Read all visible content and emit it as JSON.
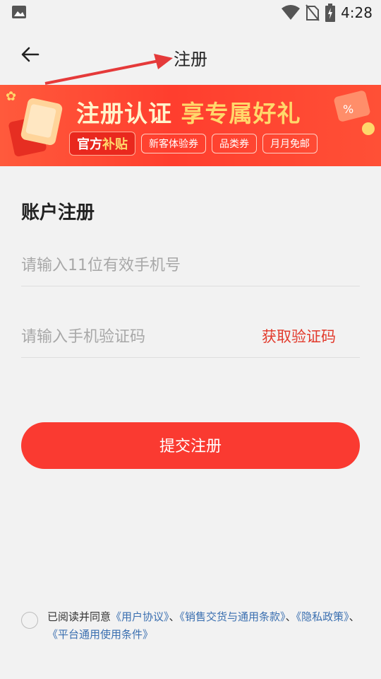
{
  "status_bar": {
    "time": "4:28",
    "icons": [
      "image-icon",
      "wifi-icon",
      "no-sim-icon",
      "battery-charging-icon"
    ]
  },
  "nav": {
    "title": "注册",
    "back_icon": "arrow-left-icon"
  },
  "banner": {
    "title_part1": "注册认证",
    "title_part2": "享专属好礼",
    "tag_main_part1": "官方",
    "tag_main_part2": "补贴",
    "tags": [
      "新客体验券",
      "品类券",
      "月月免邮"
    ]
  },
  "form": {
    "section_title": "账户注册",
    "phone_placeholder": "请输入11位有效手机号",
    "phone_value": "",
    "code_placeholder": "请输入手机验证码",
    "code_value": "",
    "get_code_label": "获取验证码",
    "submit_label": "提交注册"
  },
  "agreement": {
    "prefix": "已阅读并同意",
    "links": [
      "《用户协议》",
      "《销售交货与通用条款》",
      "《隐私政策》",
      "《平台通用使用条件》"
    ],
    "separator": "、"
  },
  "colors": {
    "accent": "#fa3a31",
    "link": "#3a6fb0",
    "background": "#f2f2f2"
  }
}
